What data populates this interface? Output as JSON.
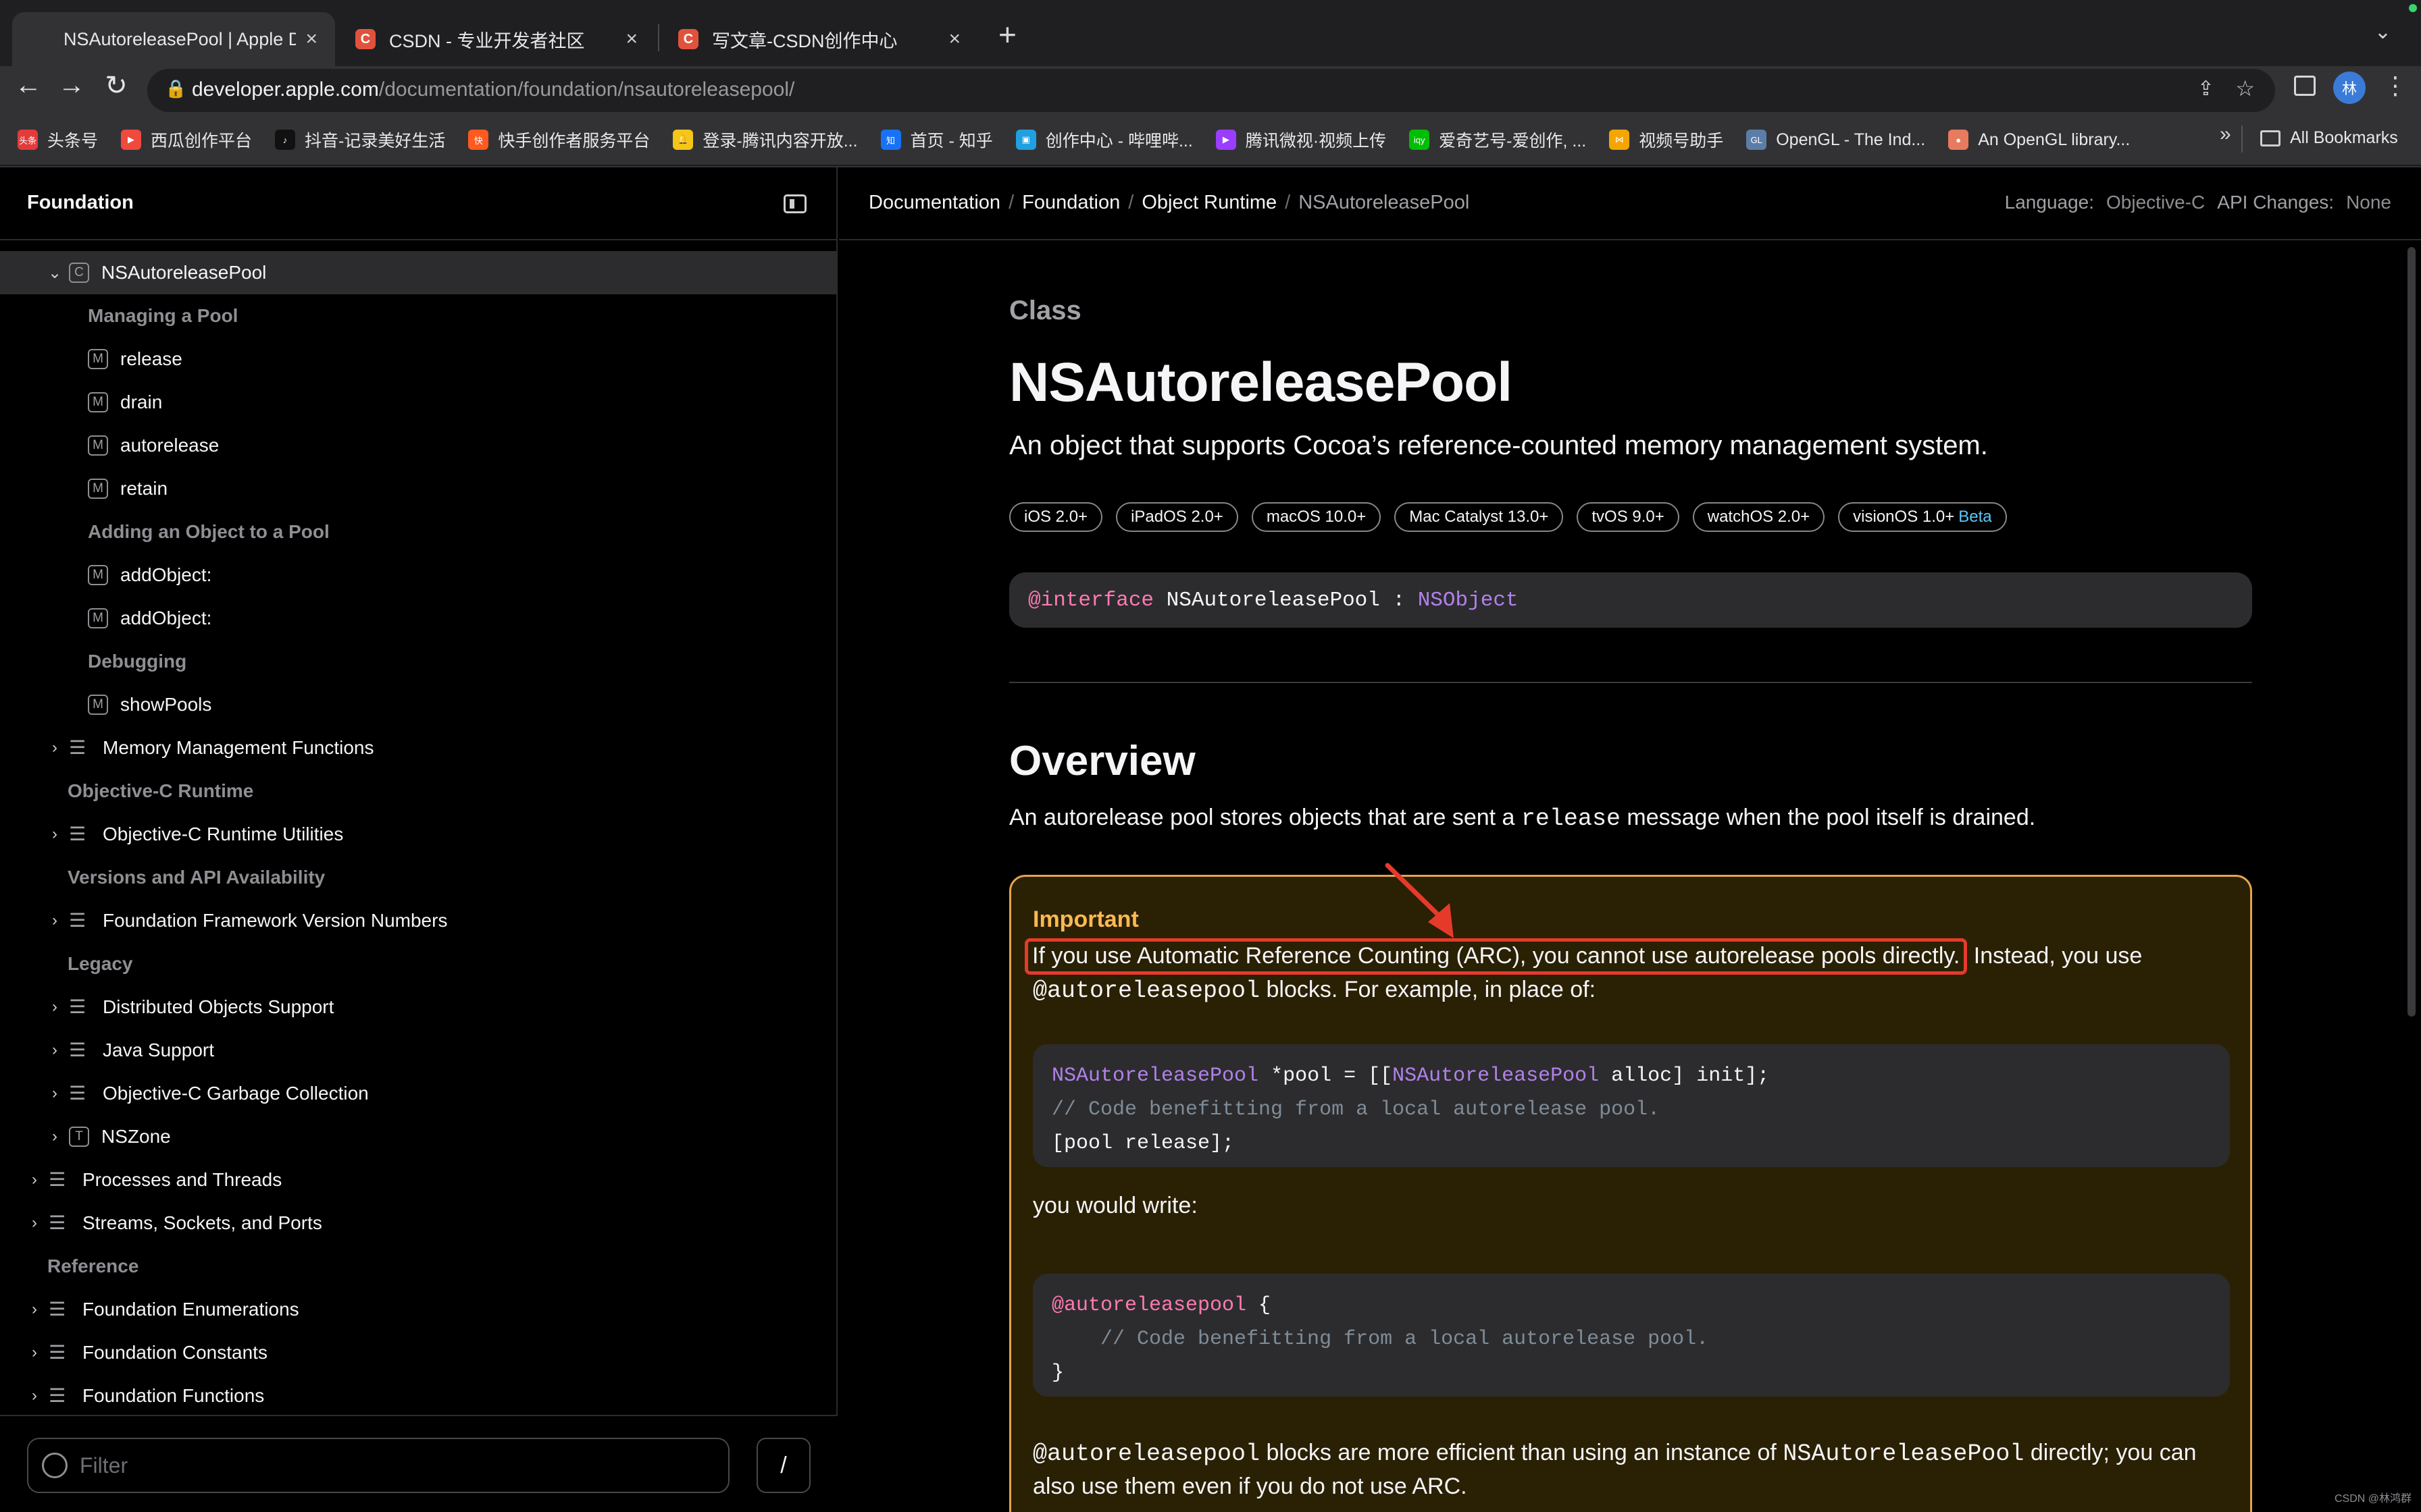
{
  "tabs": [
    {
      "title": "NSAutoreleasePool | Apple De",
      "favicon": "apple-logo-icon"
    },
    {
      "title": "CSDN - 专业开发者社区",
      "favicon": "C"
    },
    {
      "title": "写文章-CSDN创作中心",
      "favicon": "C"
    }
  ],
  "url": {
    "host": "developer.apple.com",
    "path": "/documentation/foundation/nsautoreleasepool/"
  },
  "profile_initial": "林",
  "bookmarks": [
    {
      "label": "头条号",
      "icon": "头条",
      "color": "#e33b3b"
    },
    {
      "label": "西瓜创作平台",
      "icon": "▶",
      "color": "#f0493d"
    },
    {
      "label": "抖音-记录美好生活",
      "icon": "♪",
      "color": "#111111"
    },
    {
      "label": "快手创作者服务平台",
      "icon": "快",
      "color": "#ff5a1f"
    },
    {
      "label": "登录-腾讯内容开放...",
      "icon": "🔔",
      "color": "#f5c518"
    },
    {
      "label": "首页 - 知乎",
      "icon": "知",
      "color": "#1772f6"
    },
    {
      "label": "创作中心 - 哔哩哔...",
      "icon": "▣",
      "color": "#20a0e0"
    },
    {
      "label": "腾讯微视·视频上传",
      "icon": "▶",
      "color": "#9b3dff"
    },
    {
      "label": "爱奇艺号-爱创作, ...",
      "icon": "iqy",
      "color": "#00be06"
    },
    {
      "label": "视频号助手",
      "icon": "⋈",
      "color": "#f4a500"
    },
    {
      "label": "OpenGL - The Ind...",
      "icon": "GL",
      "color": "#5b7ea8"
    },
    {
      "label": "An OpenGL library...",
      "icon": "●",
      "color": "#e87a5d"
    }
  ],
  "bookmarks_more": "»",
  "all_bookmarks": "All Bookmarks",
  "sidebar": {
    "title": "Foundation",
    "items": [
      {
        "kind": "node",
        "chevron": "⌄",
        "badge": "C",
        "label": "NSAutoreleasePool",
        "indent": 1,
        "selected": true
      },
      {
        "kind": "heading",
        "label": "Managing a Pool",
        "indent": 2
      },
      {
        "kind": "leaf",
        "badge": "M",
        "label": "release",
        "indent": 2
      },
      {
        "kind": "leaf",
        "badge": "M",
        "label": "drain",
        "indent": 2
      },
      {
        "kind": "leaf",
        "badge": "M",
        "label": "autorelease",
        "indent": 2
      },
      {
        "kind": "leaf",
        "badge": "M",
        "label": "retain",
        "indent": 2
      },
      {
        "kind": "heading",
        "label": "Adding an Object to a Pool",
        "indent": 2
      },
      {
        "kind": "leaf",
        "badge": "M",
        "label": "addObject:",
        "indent": 2
      },
      {
        "kind": "leaf",
        "badge": "M",
        "label": "addObject:",
        "indent": 2
      },
      {
        "kind": "heading",
        "label": "Debugging",
        "indent": 2
      },
      {
        "kind": "leaf",
        "badge": "M",
        "label": "showPools",
        "indent": 2
      },
      {
        "kind": "group",
        "chevron": "›",
        "label": "Memory Management Functions",
        "indent": 1
      },
      {
        "kind": "heading",
        "label": "Objective-C Runtime",
        "indent": 1
      },
      {
        "kind": "group",
        "chevron": "›",
        "label": "Objective-C Runtime Utilities",
        "indent": 1
      },
      {
        "kind": "heading",
        "label": "Versions and API Availability",
        "indent": 1
      },
      {
        "kind": "group",
        "chevron": "›",
        "label": "Foundation Framework Version Numbers",
        "indent": 1
      },
      {
        "kind": "heading",
        "label": "Legacy",
        "indent": 1
      },
      {
        "kind": "group",
        "chevron": "›",
        "label": "Distributed Objects Support",
        "indent": 1
      },
      {
        "kind": "group",
        "chevron": "›",
        "label": "Java Support",
        "indent": 1
      },
      {
        "kind": "group",
        "chevron": "›",
        "label": "Objective-C Garbage Collection",
        "indent": 1
      },
      {
        "kind": "node",
        "chevron": "›",
        "badge": "T",
        "label": "NSZone",
        "indent": 1
      },
      {
        "kind": "group",
        "chevron": "›",
        "label": "Processes and Threads",
        "indent": 0
      },
      {
        "kind": "group",
        "chevron": "›",
        "label": "Streams, Sockets, and Ports",
        "indent": 0
      },
      {
        "kind": "heading",
        "label": "Reference",
        "indent": 0
      },
      {
        "kind": "group",
        "chevron": "›",
        "label": "Foundation Enumerations",
        "indent": 0
      },
      {
        "kind": "group",
        "chevron": "›",
        "label": "Foundation Constants",
        "indent": 0
      },
      {
        "kind": "group",
        "chevron": "›",
        "label": "Foundation Functions",
        "indent": 0
      }
    ],
    "filter_placeholder": "Filter",
    "filter_shortcut": "/"
  },
  "breadcrumbs": [
    "Documentation",
    "Foundation",
    "Object Runtime",
    "NSAutoreleasePool"
  ],
  "language": {
    "label": "Language:",
    "value": "Objective-C",
    "api_label": "API Changes:",
    "api_value": "None"
  },
  "doc": {
    "eyebrow": "Class",
    "title": "NSAutoreleasePool",
    "abstract": "An object that supports Cocoa’s reference-counted memory management system.",
    "availability": [
      {
        "label": "iOS 2.0+"
      },
      {
        "label": "iPadOS 2.0+"
      },
      {
        "label": "macOS 10.0+"
      },
      {
        "label": "Mac Catalyst 13.0+"
      },
      {
        "label": "tvOS 9.0+"
      },
      {
        "label": "watchOS 2.0+"
      },
      {
        "label": "visionOS 1.0+",
        "beta": "Beta"
      }
    ],
    "declaration": {
      "keyword": "@interface",
      "name": " NSAutoreleasePool : ",
      "super": "NSObject"
    },
    "overview_heading": "Overview",
    "overview": {
      "before": "An autorelease pool stores objects that are sent a ",
      "code": "release",
      "after": " message when the pool itself is drained."
    },
    "important": {
      "label": "Important",
      "line1_highlight": "If you use Automatic Reference Counting (ARC), you cannot use autorelease pools directly.",
      "line1_rest": " Instead, you use",
      "line2_code": "@autoreleasepool",
      "line2_rest": " blocks. For example, in place of:",
      "code1": {
        "l1_type1": "NSAutoreleasePool",
        "l1_mid": " *pool = [[",
        "l1_type2": "NSAutoreleasePool",
        "l1_end": " alloc] init];",
        "l2_comment": "// Code benefitting from a local autorelease pool.",
        "l3": "[pool release];"
      },
      "you_would_write": "you would write:",
      "code2": {
        "l1_kw": "@autoreleasepool",
        "l1_end": " {",
        "l2_comment": "    // Code benefitting from a local autorelease pool.",
        "l3": "}"
      },
      "last_code1": "@autoreleasepool",
      "last_mid": " blocks are more efficient than using an instance of ",
      "last_code2": "NSAutoreleasePool",
      "last_end": " directly; you can",
      "last_line2": "also use them even if you do not use ARC."
    }
  },
  "watermark": "CSDN @林鸿群",
  "colors": {
    "highlight_box": "#e53a2a",
    "aside_border": "#e5a44a",
    "aside_label": "#fdb952",
    "keyword": "#ff7ab2",
    "type": "#b281eb",
    "comment": "#7f8c98"
  }
}
